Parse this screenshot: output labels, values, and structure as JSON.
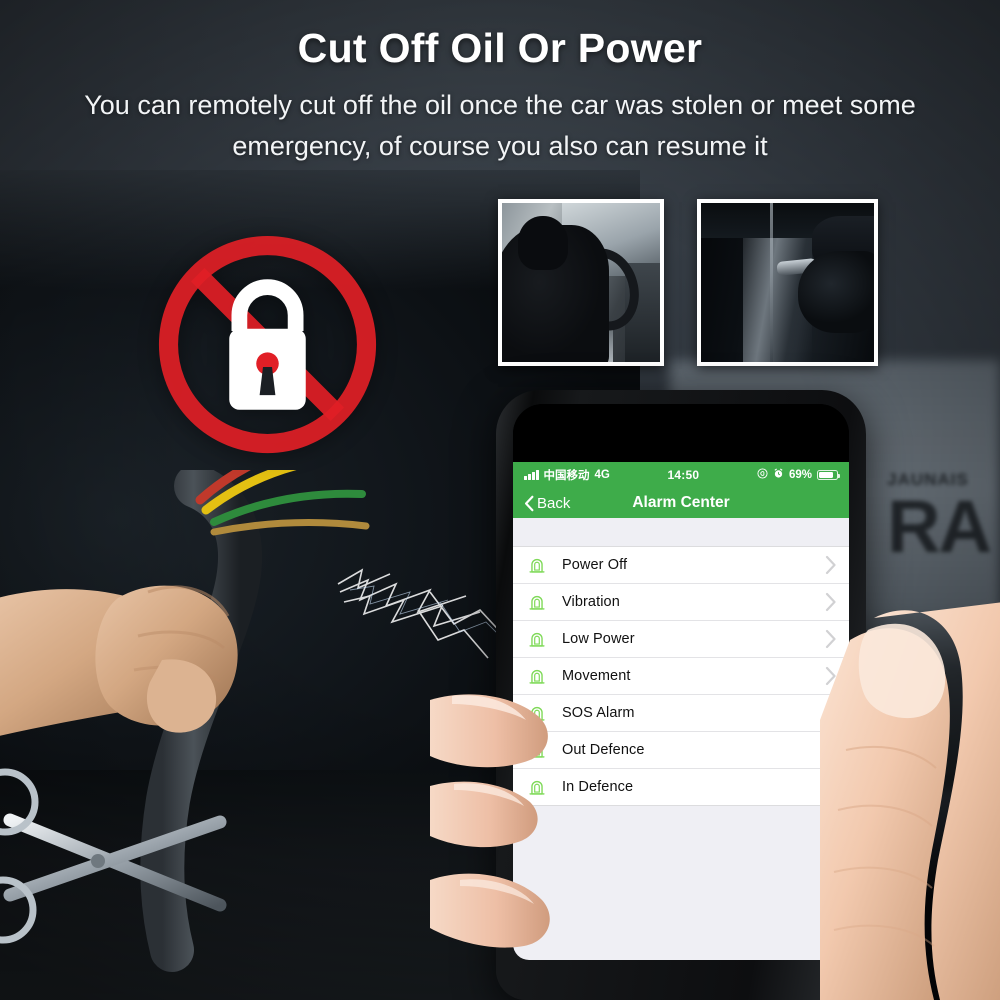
{
  "banner": {
    "title": "Cut Off Oil Or Power",
    "subtitle": "You can remotely cut off the oil once the car was stolen or meet some emergency, of course you also can resume it"
  },
  "colors": {
    "brand_green": "#3eac4a",
    "prohibition_red": "#e11f26",
    "background_dark": "#2f363d",
    "list_background": "#ffffff",
    "content_background": "#efeff4"
  },
  "graphics": {
    "no_lock_badge": "prohibition-lock-icon",
    "cable_scene": "cut-cable-with-scissors",
    "car_plate_text": "RA",
    "car_plate_sub": "JAUNAIS"
  },
  "thumbnails": [
    {
      "name": "thief-in-car-photo",
      "caption": ""
    },
    {
      "name": "thief-at-car-door-photo",
      "caption": ""
    }
  ],
  "phone": {
    "statusbar": {
      "carrier": "中国移动",
      "network": "4G",
      "time": "14:50",
      "battery_percent": "69%",
      "icons": [
        "signal-bars-icon",
        "location-icon",
        "alarm-clock-icon",
        "battery-icon"
      ]
    },
    "navbar": {
      "back_label": "Back",
      "title": "Alarm Center"
    },
    "list": [
      {
        "label": "Power Off",
        "icon": "siren-alarm-icon",
        "chevron": "chevron-right-icon"
      },
      {
        "label": "Vibration",
        "icon": "siren-alarm-icon",
        "chevron": "chevron-right-icon"
      },
      {
        "label": "Low Power",
        "icon": "siren-alarm-icon",
        "chevron": "chevron-right-icon"
      },
      {
        "label": "Movement",
        "icon": "siren-alarm-icon",
        "chevron": "chevron-right-icon"
      },
      {
        "label": "SOS Alarm",
        "icon": "siren-alarm-icon",
        "chevron": "chevron-right-icon"
      },
      {
        "label": "Out Defence",
        "icon": "siren-alarm-icon",
        "chevron": "chevron-right-icon"
      },
      {
        "label": "In Defence",
        "icon": "siren-alarm-icon",
        "chevron": "chevron-right-icon"
      }
    ]
  }
}
